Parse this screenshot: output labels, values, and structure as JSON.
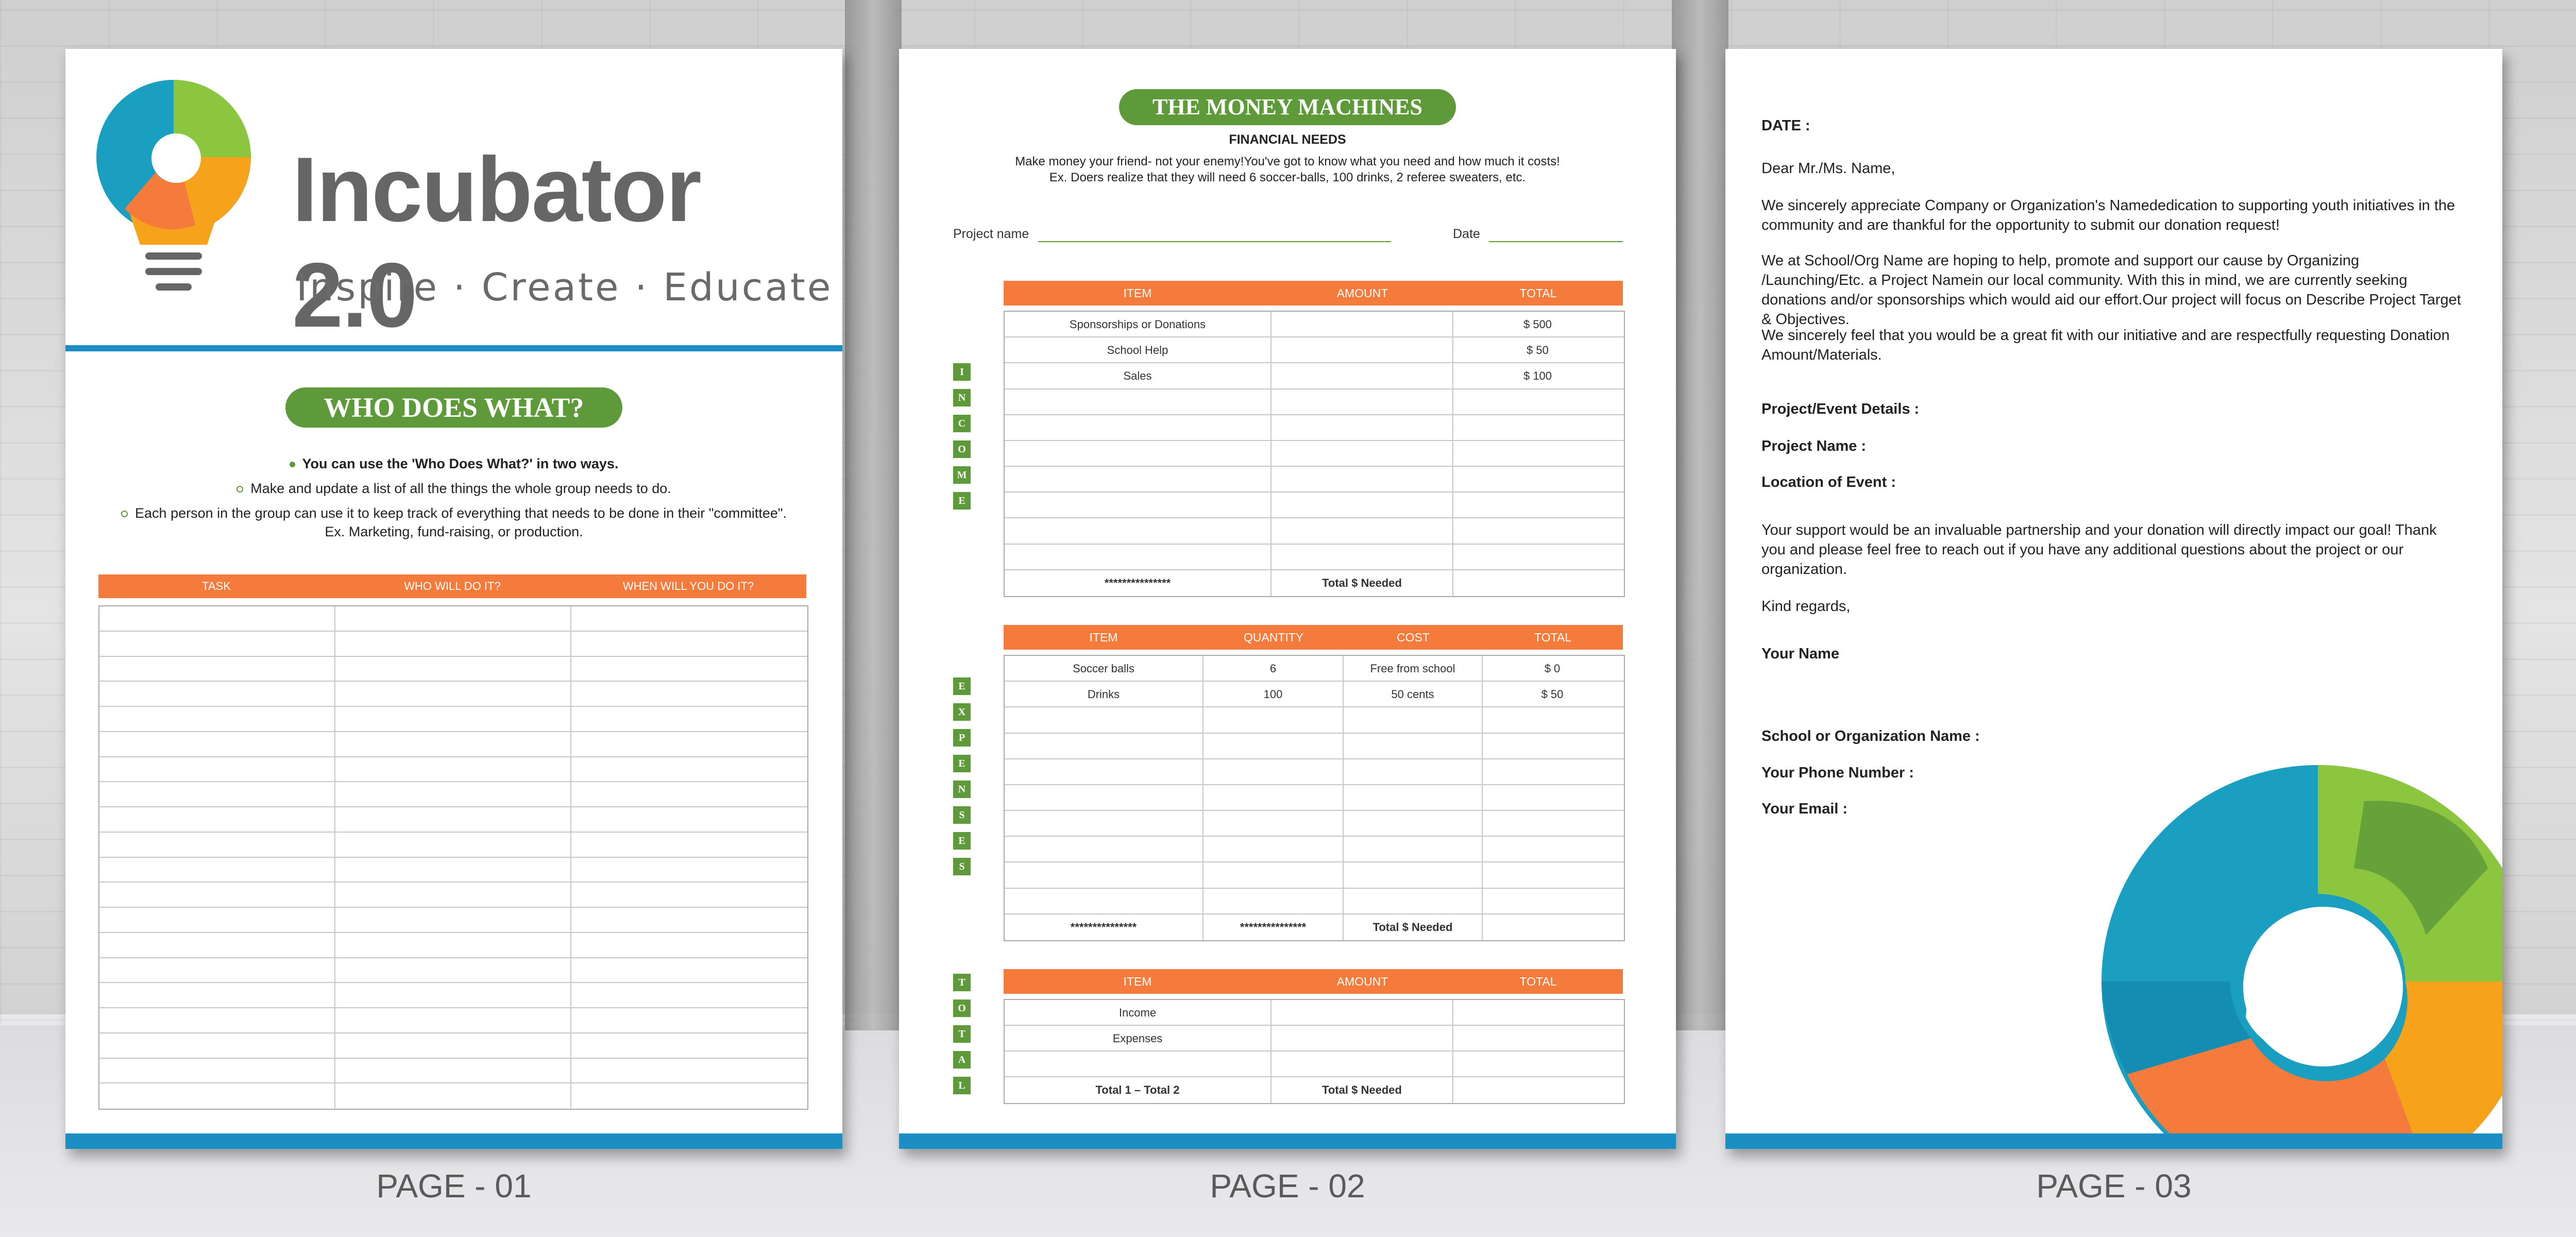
{
  "page_labels": [
    "PAGE - 01",
    "PAGE - 02",
    "PAGE - 03"
  ],
  "brand": {
    "name": "Incubator 2.0",
    "tagline": "Inspire · Create · Educate",
    "colors": {
      "blue": "#1b8fc3",
      "orange": "#f47b3b",
      "green": "#5f9a3a",
      "lime": "#8cc63f",
      "teal": "#1a9fc0"
    }
  },
  "page1": {
    "title": "WHO DOES WHAT?",
    "bullet_main": "You can use the 'Who Does What?' in two ways.",
    "bullet_1": "Make and update a list of all the things the whole group needs to do.",
    "bullet_2": "Each person in the group can use it to keep track of everything that needs to be done in their \"committee\".",
    "bullet_2b": "Ex. Marketing, fund-raising, or production.",
    "columns": [
      "TASK",
      "WHO WILL DO IT?",
      "WHEN WILL YOU DO IT?"
    ]
  },
  "page2": {
    "title": "THE MONEY MACHINES",
    "subtitle": "FINANCIAL NEEDS",
    "intro_1": "Make money your friend- not your enemy!You've got to know what you need and how much it costs!",
    "intro_2": "Ex.  Doers realize that they will need 6 soccer-balls, 100 drinks, 2 referee sweaters, etc.",
    "project_label": "Project name",
    "date_label": "Date",
    "income": {
      "label_letters": [
        "I",
        "N",
        "C",
        "O",
        "M",
        "E"
      ],
      "columns": [
        "ITEM",
        "AMOUNT",
        "TOTAL"
      ],
      "rows": [
        [
          "Sponsorships or Donations",
          "",
          "$  500"
        ],
        [
          "School Help",
          "",
          "$  50"
        ],
        [
          "Sales",
          "",
          "$  100"
        ]
      ],
      "footer": [
        "***************",
        "Total $ Needed",
        ""
      ]
    },
    "expenses": {
      "label_letters": [
        "E",
        "X",
        "P",
        "E",
        "N",
        "S",
        "E",
        "S"
      ],
      "columns": [
        "ITEM",
        "QUANTITY",
        "COST",
        "TOTAL"
      ],
      "rows": [
        [
          "Soccer balls",
          "6",
          "Free from school",
          "$  0"
        ],
        [
          "Drinks",
          "100",
          "50 cents",
          "$  50"
        ]
      ],
      "footer": [
        "***************",
        "***************",
        "Total $ Needed",
        ""
      ]
    },
    "total": {
      "label_letters": [
        "T",
        "O",
        "T",
        "A",
        "L"
      ],
      "columns": [
        "ITEM",
        "AMOUNT",
        "TOTAL"
      ],
      "rows": [
        [
          "Income",
          "",
          ""
        ],
        [
          "Expenses",
          "",
          ""
        ],
        [
          "",
          "",
          ""
        ]
      ],
      "footer": [
        "Total 1 – Total 2",
        "Total $ Needed",
        ""
      ]
    }
  },
  "page3": {
    "date_label": "DATE :",
    "salutation": "Dear Mr./Ms. Name,",
    "para1": "We sincerely appreciate Company or Organization's Namededication to supporting youth initiatives in the community and are thankful for the opportunity to submit our donation request!",
    "para2": "We at School/Org Name are hoping to help, promote and support our cause by Organizing /Launching/Etc. a Project Namein our local community. With this in mind, we are currently seeking donations and/or sponsorships which would aid our effort.Our project will focus on Describe Project Target & Objectives.",
    "para3": "We sincerely feel that you would be a great fit with our initiative and are respectfully requesting Donation Amount/Materials.",
    "details_label": "Project/Event Details :",
    "project_name_label": "Project Name :",
    "location_label": "Location of Event :",
    "para4": "Your support would be an invaluable partnership and your donation will directly impact our goal! Thank you and please feel free to reach out if you have any additional questions about the project or our organization.",
    "closing": "Kind regards,",
    "your_name": "Your Name",
    "school_label": "School or Organization Name :",
    "phone_label": "Your Phone Number :",
    "email_label": "Your Email :"
  }
}
